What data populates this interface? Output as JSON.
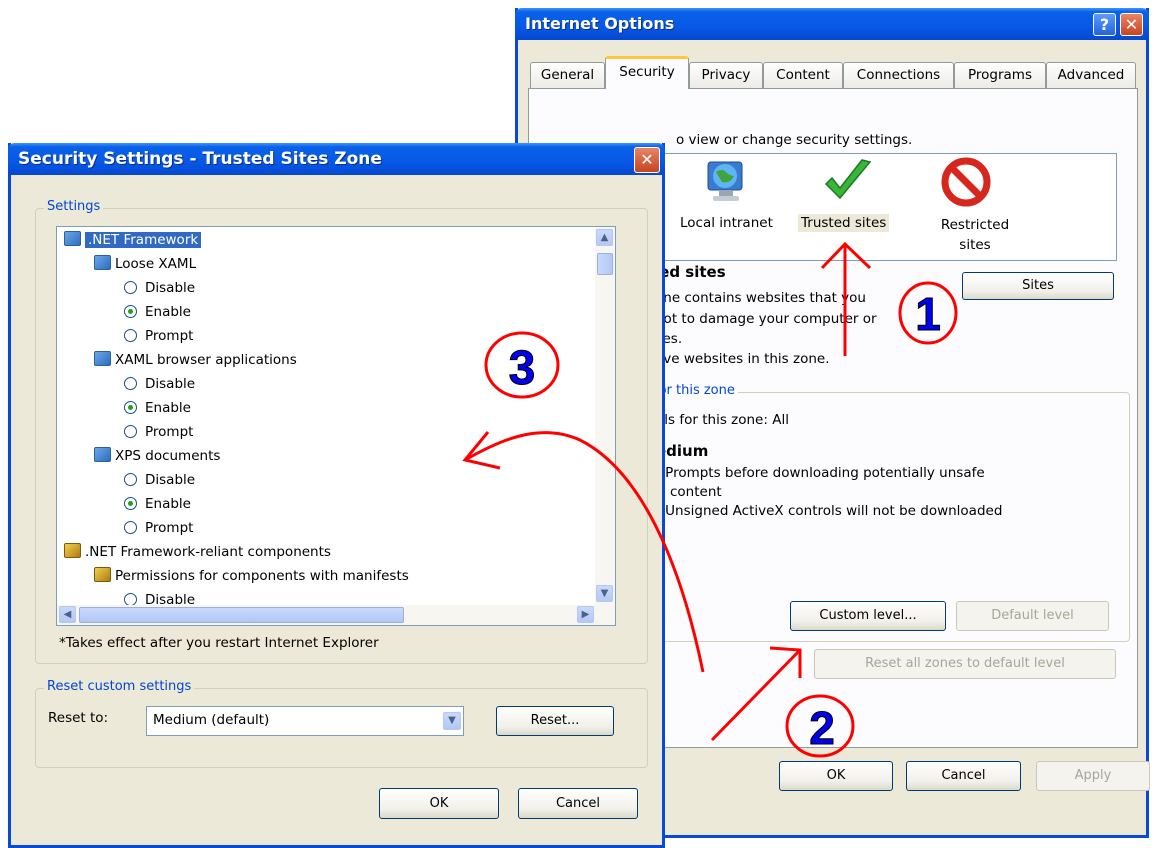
{
  "internet_options": {
    "title": "Internet Options",
    "help_glyph": "?",
    "close_glyph": "✕",
    "tabs": [
      "General",
      "Security",
      "Privacy",
      "Content",
      "Connections",
      "Programs",
      "Advanced"
    ],
    "select_zone_text": "o view or change security settings.",
    "zones": [
      "Local intranet",
      "Trusted sites",
      "Restricted sites"
    ],
    "zone_heading": "ted sites",
    "zone_desc": [
      "one contains websites that you",
      "not to damage your computer or",
      "iles.",
      "ave websites in this zone."
    ],
    "sites_button": "Sites",
    "security_level_title": "for this zone",
    "allowed_levels": "els for this zone: All",
    "level_name": "edium",
    "level_bullets": [
      "- Prompts before downloading potentially unsafe",
      "content",
      "- Unsigned ActiveX controls will not be downloaded"
    ],
    "custom_level_button": "Custom level...",
    "default_level_button": "Default level",
    "reset_all_button": "Reset all zones to default level",
    "ok_button": "OK",
    "cancel_button": "Cancel",
    "apply_button": "Apply"
  },
  "security_settings": {
    "title": "Security Settings - Trusted Sites Zone",
    "close_glyph": "✕",
    "settings_group": "Settings",
    "tree": [
      {
        "label": ".NET Framework",
        "type": "category",
        "level": 0
      },
      {
        "label": "Loose XAML",
        "type": "category",
        "level": 1
      },
      {
        "label": "Disable",
        "type": "radio",
        "level": 2,
        "checked": false
      },
      {
        "label": "Enable",
        "type": "radio",
        "level": 2,
        "checked": true
      },
      {
        "label": "Prompt",
        "type": "radio",
        "level": 2,
        "checked": false
      },
      {
        "label": "XAML browser applications",
        "type": "category",
        "level": 1
      },
      {
        "label": "Disable",
        "type": "radio",
        "level": 2,
        "checked": false
      },
      {
        "label": "Enable",
        "type": "radio",
        "level": 2,
        "checked": true
      },
      {
        "label": "Prompt",
        "type": "radio",
        "level": 2,
        "checked": false
      },
      {
        "label": "XPS documents",
        "type": "category",
        "level": 1
      },
      {
        "label": "Disable",
        "type": "radio",
        "level": 2,
        "checked": false
      },
      {
        "label": "Enable",
        "type": "radio",
        "level": 2,
        "checked": true
      },
      {
        "label": "Prompt",
        "type": "radio",
        "level": 2,
        "checked": false
      },
      {
        "label": ".NET Framework-reliant components",
        "type": "gear",
        "level": 0
      },
      {
        "label": "Permissions for components with manifests",
        "type": "gear",
        "level": 1
      },
      {
        "label": "Disable",
        "type": "radio",
        "level": 2,
        "checked": false
      }
    ],
    "restart_note": "*Takes effect after you restart Internet Explorer",
    "reset_group": "Reset custom settings",
    "reset_to_label": "Reset to:",
    "reset_to_value": "Medium (default)",
    "reset_button": "Reset...",
    "ok_button": "OK",
    "cancel_button": "Cancel"
  },
  "annotations": {
    "step1": "1",
    "step2": "2",
    "step3": "3",
    "annotation_color": "#FF0000",
    "number_color": "#0000EE"
  },
  "colors": {
    "titlebar": "#0758E6",
    "dialog_bg": "#ECE9D8",
    "selection": "#316AC5",
    "group_title": "#0046D5"
  },
  "icons": {
    "local_intranet": "globe-monitor-icon",
    "trusted_sites": "green-check-icon",
    "restricted_sites": "red-no-icon"
  }
}
